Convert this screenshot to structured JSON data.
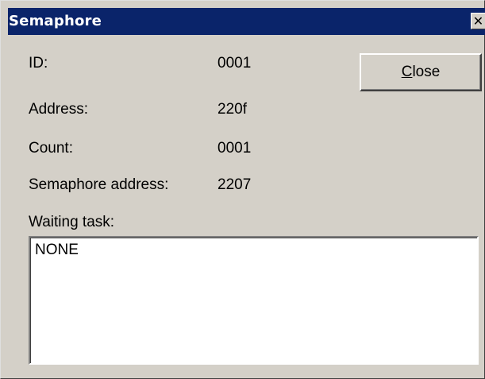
{
  "window": {
    "title": "Semaphore",
    "close_glyph": "✕"
  },
  "fields": {
    "id": {
      "label": "ID:",
      "value": "0001"
    },
    "address": {
      "label": "Address:",
      "value": "220f"
    },
    "count": {
      "label": "Count:",
      "value": "0001"
    },
    "semaphore_address": {
      "label": "Semaphore address:",
      "value": "2207"
    }
  },
  "close_button": {
    "mnemonic": "C",
    "rest": "lose"
  },
  "waiting_task": {
    "label": "Waiting task:",
    "value": "NONE"
  },
  "colors": {
    "titlebar": "#0a246a",
    "face": "#d4d0c8",
    "field": "#ffffff"
  }
}
